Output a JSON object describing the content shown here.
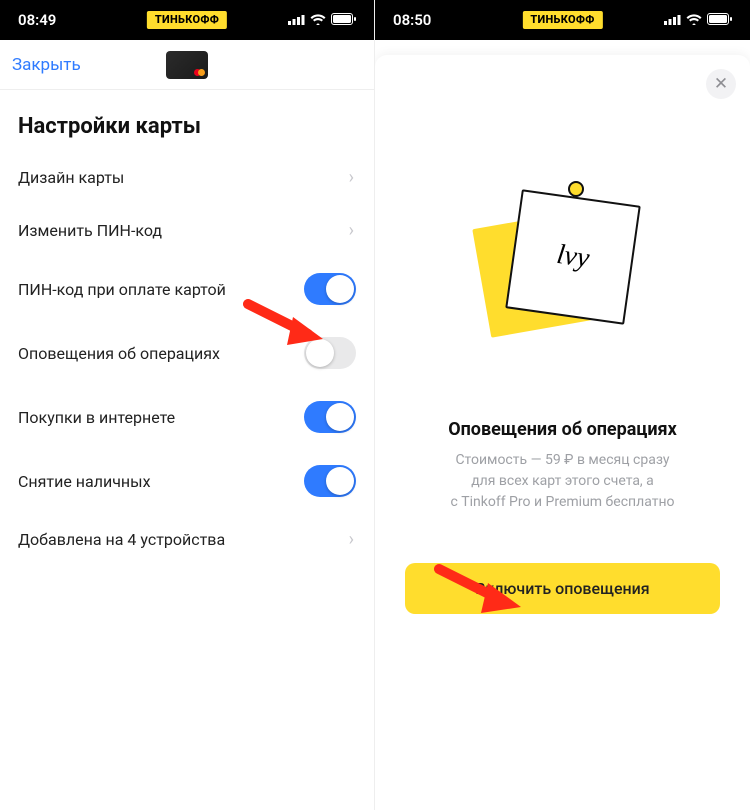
{
  "left": {
    "status": {
      "time": "08:49",
      "brand": "ТИНЬКОФФ"
    },
    "close": "Закрыть",
    "title": "Настройки карты",
    "rows": [
      {
        "label": "Дизайн карты",
        "type": "nav"
      },
      {
        "label": "Изменить ПИН-код",
        "type": "nav"
      },
      {
        "label": "ПИН-код при оплате картой",
        "type": "toggle",
        "on": true
      },
      {
        "label": "Оповещения об операциях",
        "type": "toggle",
        "on": false
      },
      {
        "label": "Покупки в интернете",
        "type": "toggle",
        "on": true
      },
      {
        "label": "Снятие наличных",
        "type": "toggle",
        "on": true
      },
      {
        "label": "Добавлена на 4 устройства",
        "type": "nav"
      }
    ]
  },
  "right": {
    "status": {
      "time": "08:50",
      "brand": "ТИНЬКОФФ"
    },
    "modal": {
      "title": "Оповещения об операциях",
      "desc_line1": "Стоимость — 59 ₽ в месяц сразу",
      "desc_line2": "для всех карт этого счета, а",
      "desc_line3": "с Tinkoff Pro и Premium бесплатно",
      "cta": "Включить оповещения"
    }
  }
}
